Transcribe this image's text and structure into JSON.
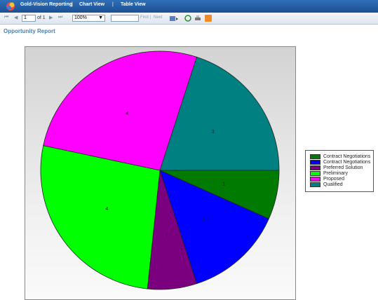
{
  "topbar": {
    "links": [
      "Gold-Vision Reporting",
      "Chart View",
      "Table View"
    ],
    "separator": "|"
  },
  "toolbar": {
    "page_value": "1",
    "page_of": "of 1",
    "zoom_value": "100%",
    "find_label": "Find",
    "next_label": "Next",
    "link_separator": "|"
  },
  "report": {
    "title": "Opportunity Report"
  },
  "chart_data": {
    "type": "pie",
    "categories": [
      "Contract Negotiations",
      "Preferred Solution",
      "Preliminary",
      "Proposed",
      "Qualified"
    ],
    "slices": [
      {
        "label": "Contract Negotiations",
        "value": 1,
        "color": "#007a00"
      },
      {
        "label": "Contract Negotiations",
        "value": 2,
        "color": "#0000ff"
      },
      {
        "label": "Preferred Solution",
        "value": 1,
        "color": "#7b0080"
      },
      {
        "label": "Preliminary",
        "value": 4,
        "color": "#00ff00"
      },
      {
        "label": "Proposed",
        "value": 4,
        "color": "#ff00ff"
      },
      {
        "label": "Qualified",
        "value": 3,
        "color": "#008080"
      }
    ],
    "legend": [
      {
        "label": "Contract Negotiations",
        "color": "#007a00"
      },
      {
        "label": "Contract Negotiations",
        "color": "#0000ff"
      },
      {
        "label": "Preferred Solution",
        "color": "#7b0080"
      },
      {
        "label": "Preliminary",
        "color": "#00ff00"
      },
      {
        "label": "Proposed",
        "color": "#ff00ff"
      },
      {
        "label": "Qualified",
        "color": "#008080"
      }
    ],
    "legend_placement": "right"
  }
}
